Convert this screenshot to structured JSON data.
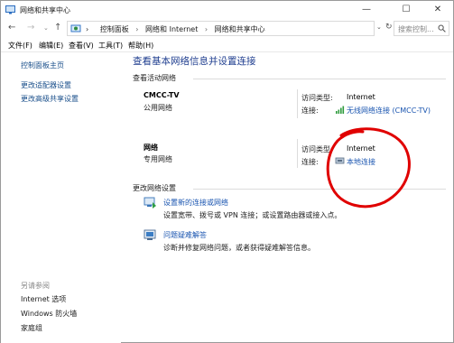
{
  "window": {
    "title": "网络和共享中心",
    "minimize_glyph": "—",
    "maximize_glyph": "☐",
    "close_glyph": "✕"
  },
  "nav": {
    "back_glyph": "←",
    "forward_glyph": "→",
    "recent_glyph": "⌄",
    "up_glyph": "↑",
    "address_chevron_glyph": "⌄",
    "refresh_glyph": "↻"
  },
  "breadcrumb": {
    "lead_sep": "›",
    "items": [
      "控制面板",
      "网络和 Internet",
      "网络和共享中心"
    ],
    "sep": "›"
  },
  "search": {
    "placeholder": "搜索控制..."
  },
  "menu": {
    "file": "文件(F)",
    "edit": "编辑(E)",
    "view": "查看(V)",
    "tools": "工具(T)",
    "help": "帮助(H)"
  },
  "leftpane": {
    "home": "控制面板主页",
    "adapter": "更改适配器设置",
    "sharing": "更改高级共享设置",
    "see_also": "另请参阅",
    "internet_options": "Internet 选项",
    "firewall": "Windows 防火墙",
    "homegroup": "家庭组"
  },
  "main": {
    "title": "查看基本网络信息并设置连接",
    "active_header": "查看活动网络",
    "networks": [
      {
        "name": "CMCC-TV",
        "type": "公用网络",
        "access_label": "访问类型:",
        "access_value": "Internet",
        "conn_label": "连接:",
        "conn_value": "无线网络连接 (CMCC-TV)"
      },
      {
        "name": "网络",
        "type": "专用网络",
        "access_label": "访问类型:",
        "access_value": "Internet",
        "conn_label": "连接:",
        "conn_value": "本地连接"
      }
    ],
    "change_header": "更改网络设置",
    "tasks": [
      {
        "link": "设置新的连接或网络",
        "desc": "设置宽带、拨号或 VPN 连接；或设置路由器或接入点。"
      },
      {
        "link": "问题疑难解答",
        "desc": "诊断并修复网络问题，或者获得疑难解答信息。"
      }
    ]
  },
  "colors": {
    "link": "#1a55b0",
    "title": "#1e3d8f",
    "annotation": "#e00000"
  }
}
